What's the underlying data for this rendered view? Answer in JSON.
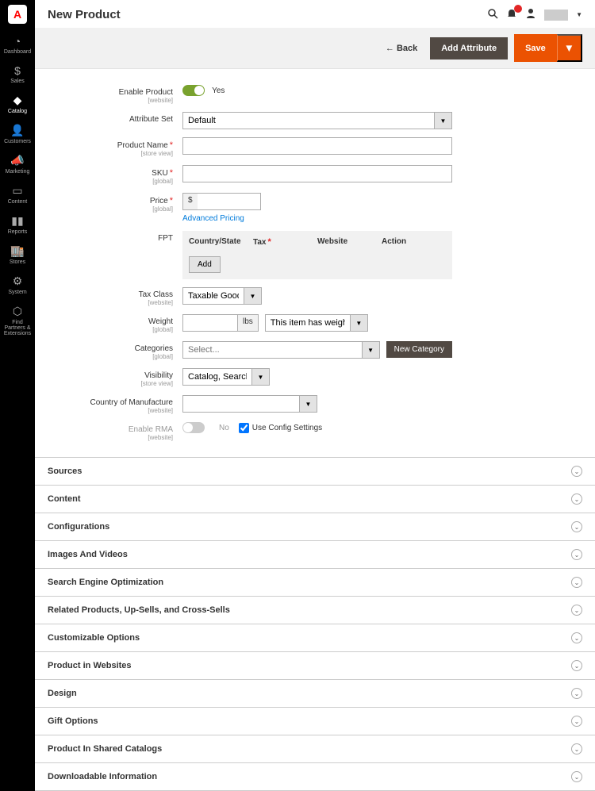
{
  "sidebar": {
    "items": [
      {
        "label": "Dashboard",
        "icon": "◔"
      },
      {
        "label": "Sales",
        "icon": "$"
      },
      {
        "label": "Catalog",
        "icon": "◆",
        "active": true
      },
      {
        "label": "Customers",
        "icon": "👤"
      },
      {
        "label": "Marketing",
        "icon": "📣"
      },
      {
        "label": "Content",
        "icon": "▭"
      },
      {
        "label": "Reports",
        "icon": "▮▮"
      },
      {
        "label": "Stores",
        "icon": "🏬"
      },
      {
        "label": "System",
        "icon": "⚙"
      },
      {
        "label": "Find Partners & Extensions",
        "icon": "⬡"
      }
    ]
  },
  "header": {
    "title": "New Product"
  },
  "action_bar": {
    "back": "Back",
    "add_attribute": "Add Attribute",
    "save": "Save"
  },
  "form": {
    "enable_product": {
      "label": "Enable Product",
      "scope": "[website]",
      "value": "Yes"
    },
    "attribute_set": {
      "label": "Attribute Set",
      "value": "Default"
    },
    "product_name": {
      "label": "Product Name",
      "scope": "[store view]",
      "value": ""
    },
    "sku": {
      "label": "SKU",
      "scope": "[global]",
      "value": ""
    },
    "price": {
      "label": "Price",
      "scope": "[global]",
      "currency": "$",
      "value": "",
      "advanced_link": "Advanced Pricing"
    },
    "fpt": {
      "label": "FPT",
      "columns": [
        "Country/State",
        "Tax",
        "Website",
        "Action"
      ],
      "add_button": "Add"
    },
    "tax_class": {
      "label": "Tax Class",
      "scope": "[website]",
      "value": "Taxable Goods"
    },
    "weight": {
      "label": "Weight",
      "scope": "[global]",
      "unit": "lbs",
      "value": "",
      "has_weight": "This item has weight"
    },
    "categories": {
      "label": "Categories",
      "scope": "[global]",
      "placeholder": "Select...",
      "new_button": "New Category"
    },
    "visibility": {
      "label": "Visibility",
      "scope": "[store view]",
      "value": "Catalog, Search"
    },
    "country": {
      "label": "Country of Manufacture",
      "scope": "[website]",
      "value": ""
    },
    "enable_rma": {
      "label": "Enable RMA",
      "scope": "[website]",
      "value": "No",
      "use_config": "Use Config Settings"
    }
  },
  "sections": [
    "Sources",
    "Content",
    "Configurations",
    "Images And Videos",
    "Search Engine Optimization",
    "Related Products, Up-Sells, and Cross-Sells",
    "Customizable Options",
    "Product in Websites",
    "Design",
    "Gift Options",
    "Product In Shared Catalogs",
    "Downloadable Information"
  ]
}
